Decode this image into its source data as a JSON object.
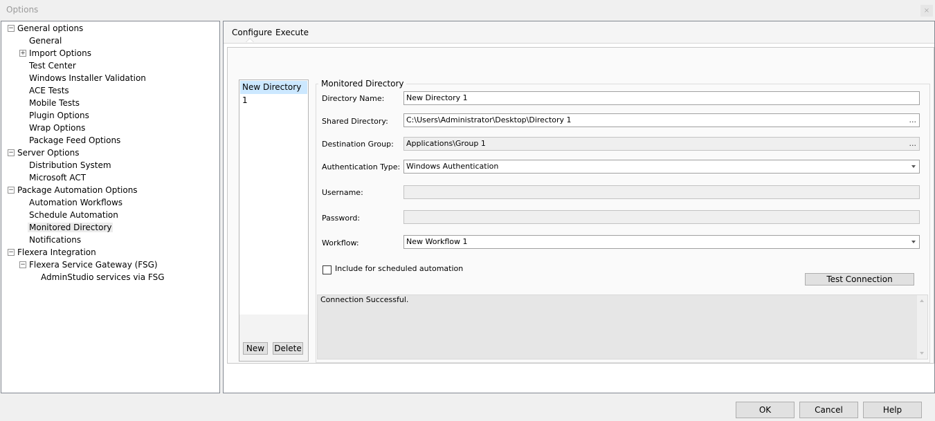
{
  "window": {
    "title": "Options",
    "close_glyph": "×"
  },
  "tree": [
    {
      "label": "General options",
      "expander": "−"
    },
    {
      "label": "General"
    },
    {
      "label": "Import Options",
      "expander": "+"
    },
    {
      "label": "Test Center"
    },
    {
      "label": "Windows Installer Validation"
    },
    {
      "label": "ACE Tests"
    },
    {
      "label": "Mobile Tests"
    },
    {
      "label": "Plugin Options"
    },
    {
      "label": "Wrap Options"
    },
    {
      "label": "Package Feed Options"
    },
    {
      "label": "Server Options",
      "expander": "−"
    },
    {
      "label": "Distribution System"
    },
    {
      "label": "Microsoft ACT"
    },
    {
      "label": "Package Automation Options",
      "expander": "−"
    },
    {
      "label": "Automation Workflows"
    },
    {
      "label": "Schedule Automation"
    },
    {
      "label": "Monitored Directory",
      "selected": true
    },
    {
      "label": "Notifications"
    },
    {
      "label": "Flexera Integration",
      "expander": "−"
    },
    {
      "label": "Flexera Service Gateway (FSG)",
      "expander": "−"
    },
    {
      "label": "AdminStudio services via FSG"
    }
  ],
  "tabs": {
    "configure": "Configure",
    "execute": "Execute"
  },
  "directories": {
    "items": [
      "New Directory 1"
    ],
    "new_label": "New",
    "delete_label": "Delete"
  },
  "group": {
    "title": "Monitored Directory"
  },
  "fields": {
    "directory_name": {
      "label": "Directory Name:",
      "value": "New Directory 1"
    },
    "shared_directory": {
      "label": "Shared Directory:",
      "value": "C:\\Users\\Administrator\\Desktop\\Directory 1",
      "button": "..."
    },
    "destination_group": {
      "label": "Destination Group:",
      "value": "Applications\\Group 1",
      "button": "..."
    },
    "authentication_type": {
      "label": "Authentication Type:",
      "value": "Windows Authentication"
    },
    "username": {
      "label": "Username:",
      "value": ""
    },
    "password": {
      "label": "Password:",
      "value": ""
    },
    "workflow": {
      "label": "Workflow:",
      "value": "New Workflow 1"
    }
  },
  "include_scheduled": {
    "label": "Include for scheduled automation",
    "checked": false
  },
  "test_connection_label": "Test Connection",
  "result_text": "Connection Successful.",
  "dialog_buttons": {
    "ok": "OK",
    "cancel": "Cancel",
    "help": "Help"
  }
}
